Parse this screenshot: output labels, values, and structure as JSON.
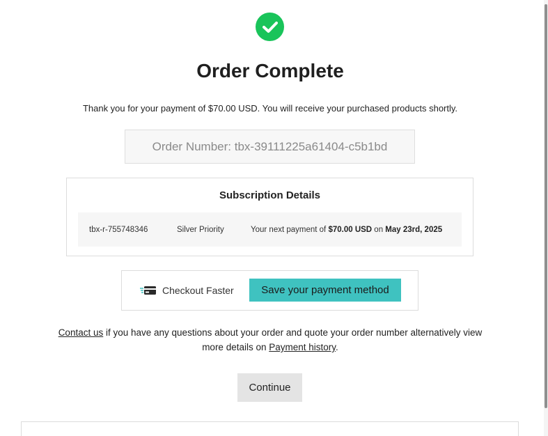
{
  "header": {
    "title": "Order Complete",
    "thanks_message": "Thank you for your payment of $70.00 USD. You will receive your purchased products shortly."
  },
  "order": {
    "number_text": "Order Number: tbx-39111225a61404-c5b1bd"
  },
  "subscription": {
    "title": "Subscription Details",
    "id": "tbx-r-755748346",
    "plan": "Silver Priority",
    "next_payment_prefix": "Your next payment of ",
    "next_payment_amount": "$70.00 USD",
    "next_payment_on": " on ",
    "next_payment_date": "May 23rd, 2025"
  },
  "checkout": {
    "icon": "credit-card-icon",
    "label": "Checkout Faster",
    "save_label": "Save your payment method"
  },
  "help": {
    "contact_link": "Contact us",
    "text_middle": " if you have any questions about your order and quote your order number alternatively view more details on ",
    "payment_history_link": "Payment history",
    "text_end": "."
  },
  "actions": {
    "continue_label": "Continue"
  },
  "colors": {
    "success": "#19c45a",
    "accent": "#3fc2c0",
    "button_gray": "#e4e4e4"
  }
}
